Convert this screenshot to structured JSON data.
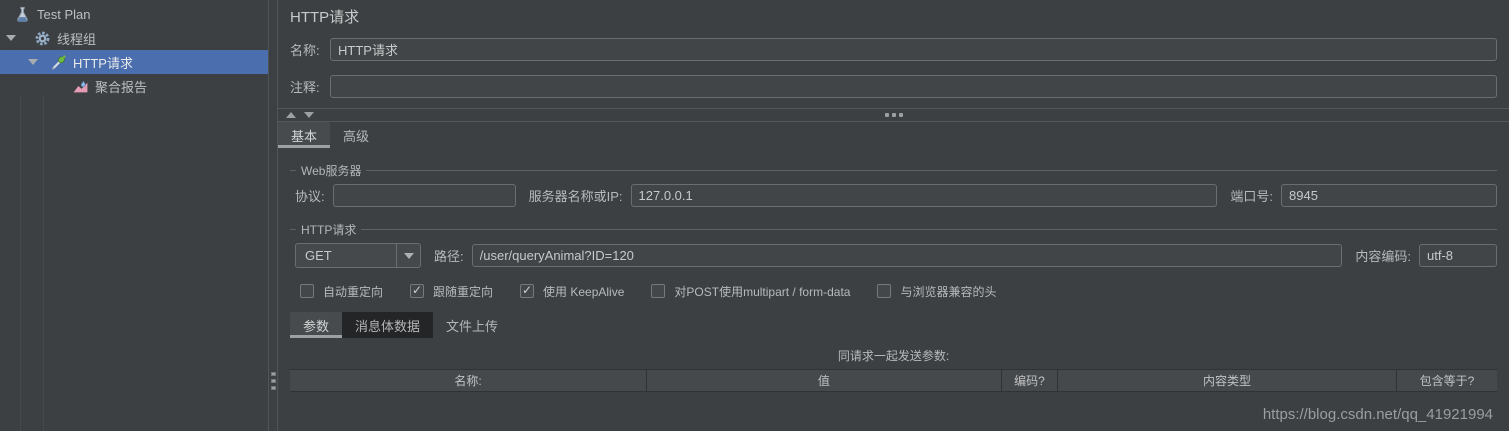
{
  "tree": {
    "items": [
      {
        "label": "Test Plan",
        "icon": "test-plan-icon",
        "selected": false,
        "expanded": false
      },
      {
        "label": "线程组",
        "icon": "thread-group-icon",
        "selected": false,
        "expanded": true
      },
      {
        "label": "HTTP请求",
        "icon": "http-sampler-icon",
        "selected": true,
        "expanded": true
      },
      {
        "label": "聚合报告",
        "icon": "aggregate-report-icon",
        "selected": false,
        "expanded": false
      }
    ]
  },
  "main": {
    "title": "HTTP请求",
    "name_label": "名称:",
    "name_value": "HTTP请求",
    "comment_label": "注释:",
    "comment_value": "",
    "tabs": [
      {
        "label": "基本",
        "active": true
      },
      {
        "label": "高级",
        "active": false
      }
    ],
    "web_server": {
      "group_title": "Web服务器",
      "protocol_label": "协议:",
      "protocol_value": "",
      "server_label": "服务器名称或IP:",
      "server_value": "127.0.0.1",
      "port_label": "端口号:",
      "port_value": "8945"
    },
    "http_request": {
      "group_title": "HTTP请求",
      "method_value": "GET",
      "path_label": "路径:",
      "path_value": "/user/queryAnimal?ID=120",
      "encoding_label": "内容编码:",
      "encoding_value": "utf-8",
      "checkboxes": [
        {
          "label": "自动重定向",
          "checked": false
        },
        {
          "label": "跟随重定向",
          "checked": true
        },
        {
          "label": "使用 KeepAlive",
          "checked": true
        },
        {
          "label": "对POST使用multipart / form-data",
          "checked": false
        },
        {
          "label": "与浏览器兼容的头",
          "checked": false
        }
      ]
    },
    "param_tabs": [
      {
        "label": "参数",
        "active": true
      },
      {
        "label": "消息体数据",
        "active": false
      },
      {
        "label": "文件上传",
        "active": false
      }
    ],
    "params_table": {
      "caption": "同请求一起发送参数:",
      "headers": [
        "名称:",
        "值",
        "编码?",
        "内容类型",
        "包含等于?"
      ]
    }
  },
  "watermark": "https://blog.csdn.net/qq_41921994",
  "colors": {
    "selection_blue": "#4b6eaf",
    "panel_background": "#3c4043",
    "tab_underline": "#9ea1a3",
    "dark_tab_background": "#232527"
  }
}
